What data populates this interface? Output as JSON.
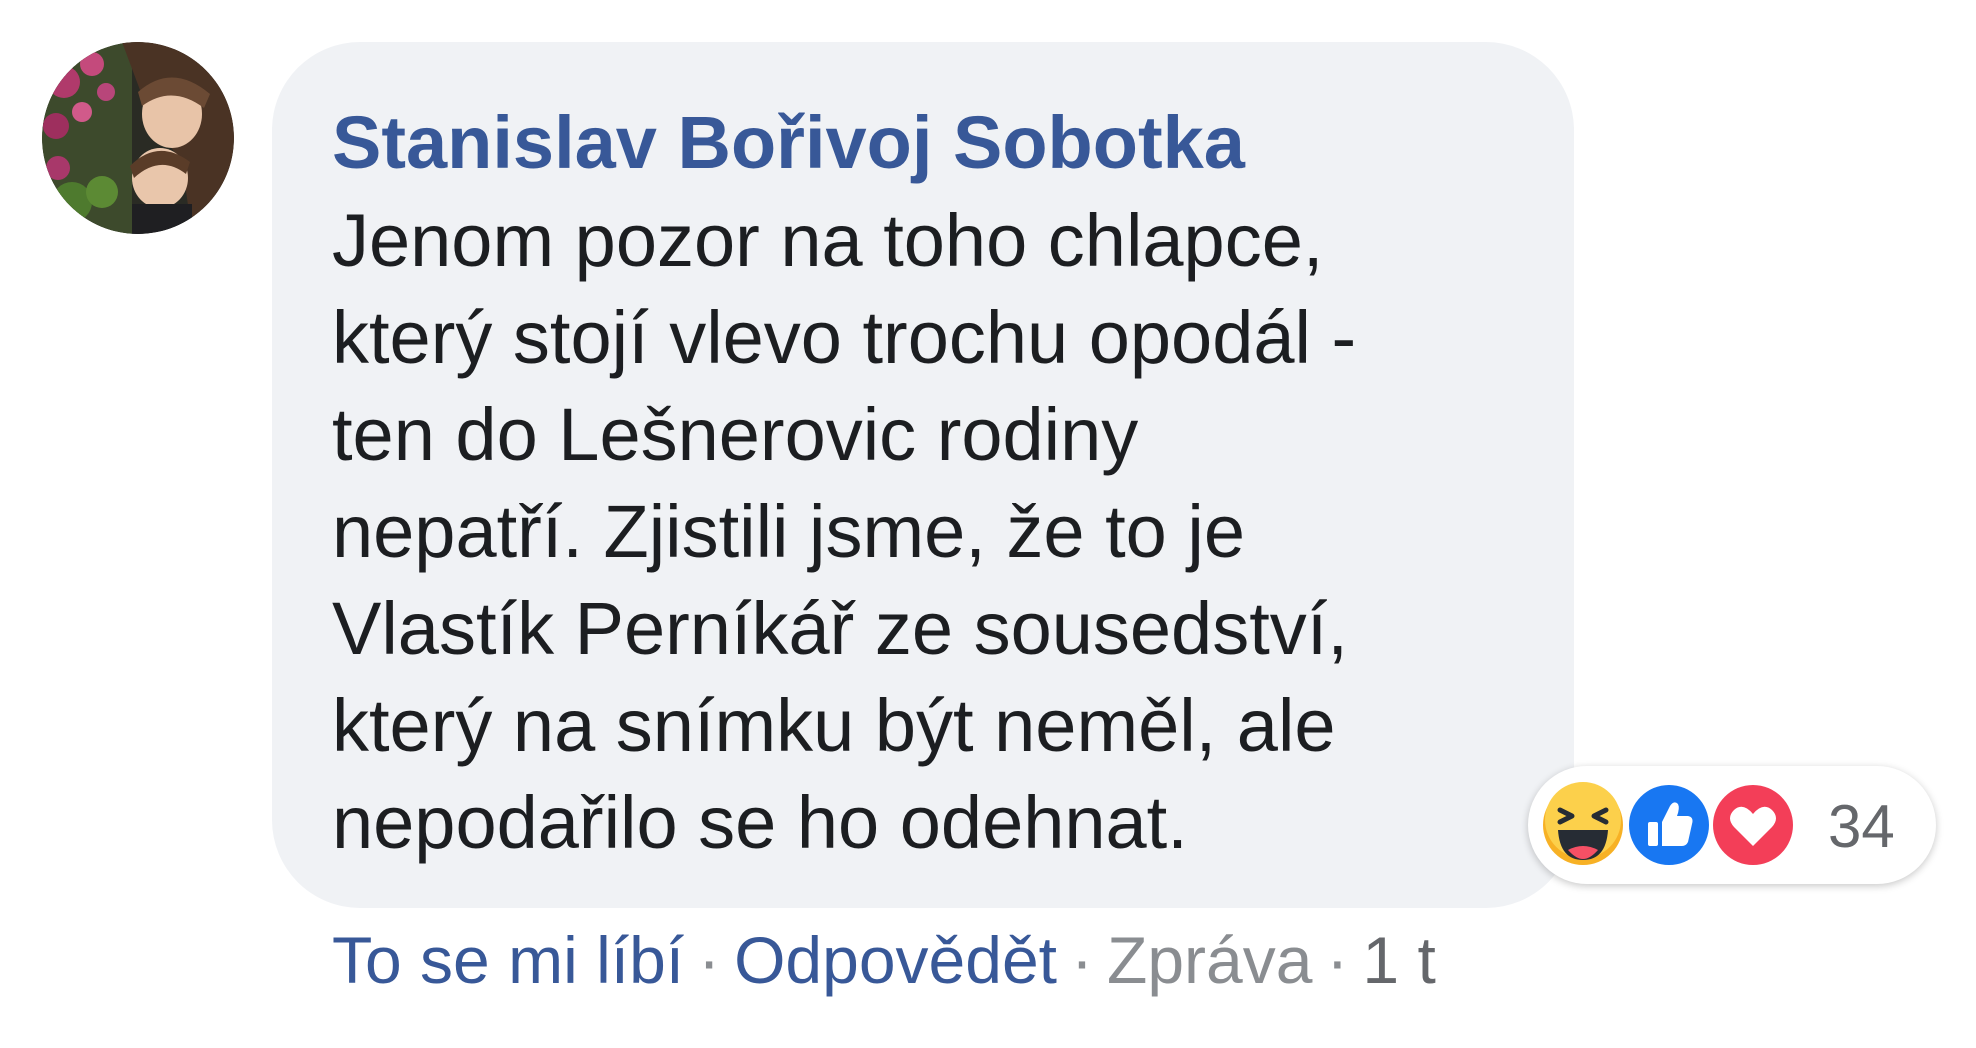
{
  "comment": {
    "author": "Stanislav Bořivoj Sobotka",
    "text_lines": [
      "Jenom pozor na toho chlapce,",
      "který stojí vlevo trochu opodál -",
      "ten do Lešnerovic rodiny",
      "nepatří. Zjistili jsme, že to je",
      "Vlastík Perníkář ze sousedství,",
      "který na snímku být neměl, ale",
      "nepodařilo se ho odehnat."
    ]
  },
  "reactions": {
    "icons": [
      "haha-icon",
      "like-icon",
      "love-icon"
    ],
    "count": "34"
  },
  "actions": {
    "like": "To se mi líbí",
    "reply": "Odpovědět",
    "message": "Zpráva",
    "time": "1 t",
    "separator": "·"
  },
  "colors": {
    "link_blue": "#385898",
    "bubble_bg": "#f0f2f5",
    "text": "#1c1e21",
    "muted": "#8a8d91",
    "like_blue": "#1877f2",
    "love_red": "#f33e58",
    "haha_yellow": "#f7b125"
  }
}
